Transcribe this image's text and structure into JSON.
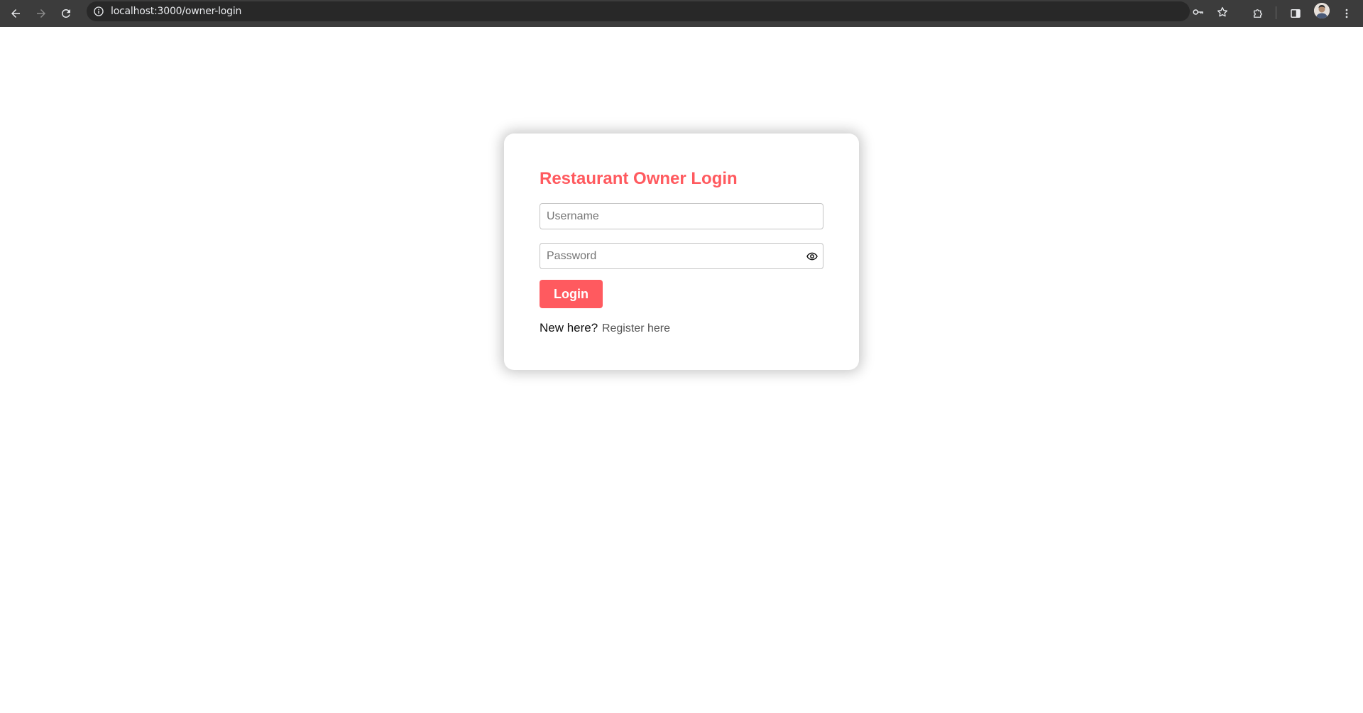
{
  "browser": {
    "url": "localhost:3000/owner-login",
    "icons": {
      "back": "arrow-left-icon",
      "forward": "arrow-right-icon",
      "reload": "reload-icon",
      "site_info": "info-icon",
      "password_manager": "key-icon",
      "bookmark": "star-icon",
      "extensions": "puzzle-icon",
      "side_panel": "side-panel-icon",
      "profile": "avatar",
      "menu": "kebab-menu-icon"
    }
  },
  "login_card": {
    "title": "Restaurant Owner Login",
    "username_placeholder": "Username",
    "username_value": "",
    "password_placeholder": "Password",
    "password_value": "",
    "password_toggle_icon": "eye-icon",
    "login_label": "Login",
    "new_here_text": "New here?",
    "register_link_text": "Register here"
  },
  "colors": {
    "accent": "#ff5a5f",
    "browser_bar": "#3c3c3c",
    "omnibox": "#282828",
    "link": "#555555"
  }
}
